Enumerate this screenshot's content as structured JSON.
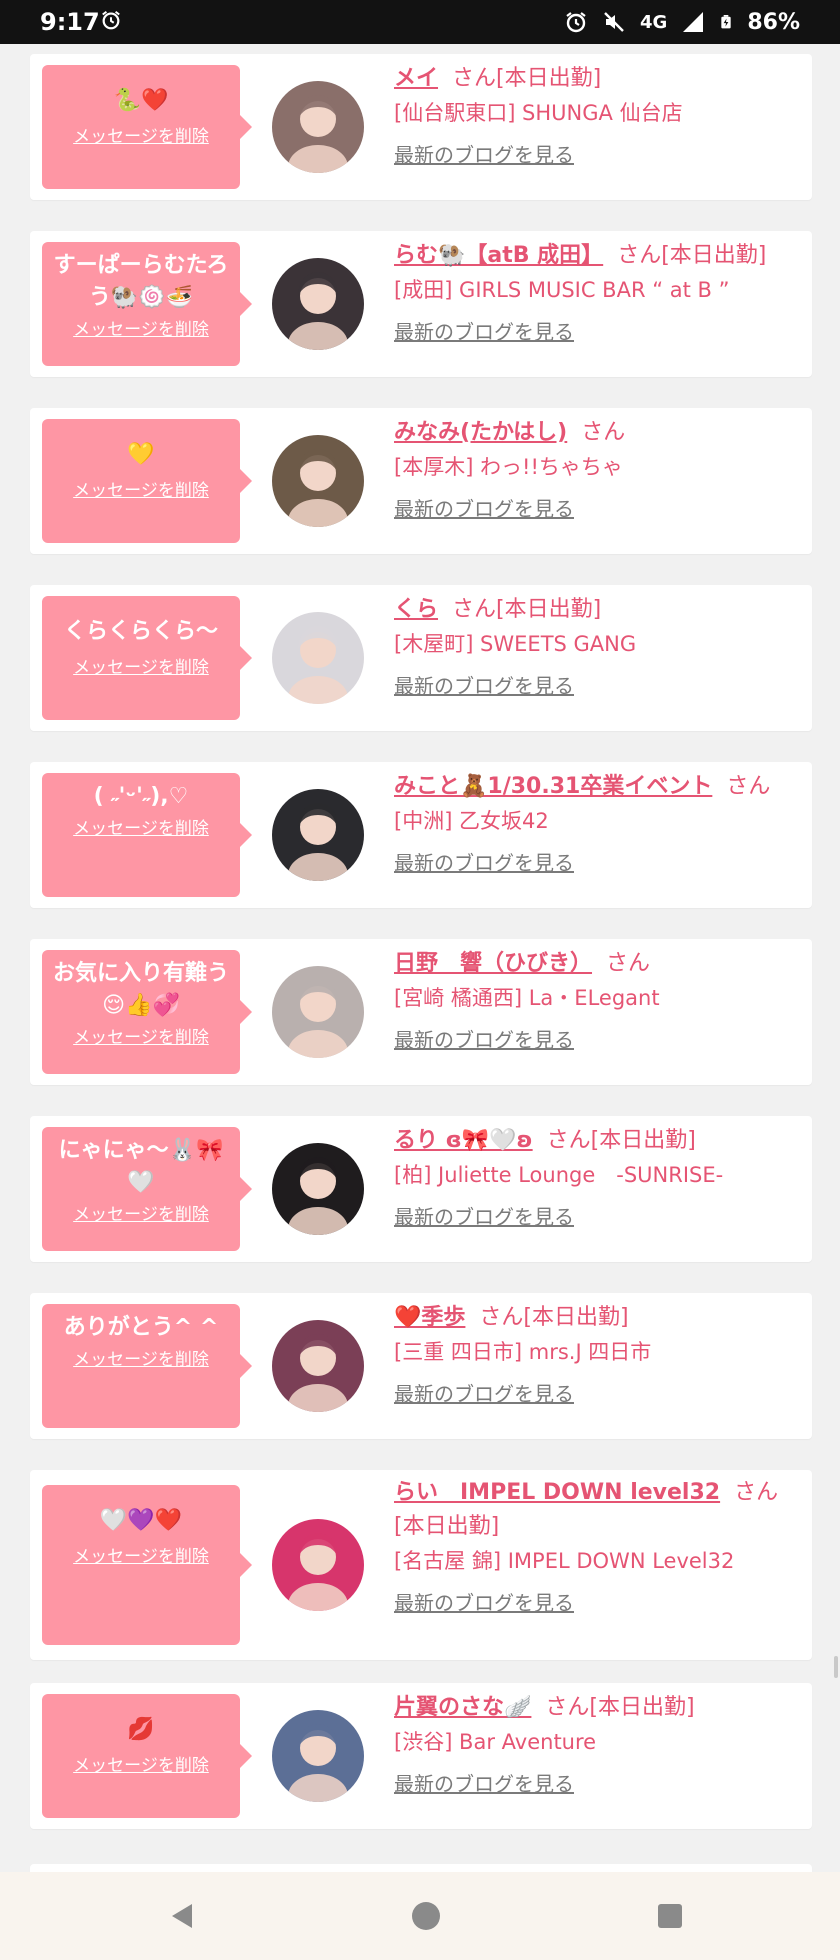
{
  "status": {
    "time": "9:17",
    "network": "4G",
    "battery": "86%"
  },
  "list": {
    "delete_label": "メッセージを削除",
    "blog_label": "最新のブログを見る",
    "items": [
      {
        "message": "🐍❤️",
        "name": "メイ",
        "suffix": "さん[本日出勤]",
        "shop": "[仙台駅東口] SHUNGA 仙台店",
        "avatar_color": "#8a6f6a"
      },
      {
        "message": "すーぱーらむたろう🐏🍥🍜",
        "name": "らむ🐏【atB 成田】",
        "suffix": "さん[本日出勤]",
        "shop": "[成田] GIRLS MUSIC BAR “ at B ”",
        "avatar_color": "#3b3337"
      },
      {
        "message": "💛",
        "name": "みなみ(たかはし)",
        "suffix": "さん",
        "shop": "[本厚木] わっ!!ちゃちゃ",
        "avatar_color": "#6d5a48"
      },
      {
        "message": "くらくらくら〜",
        "name": "くら",
        "suffix": "さん[本日出勤]",
        "shop": "[木屋町] SWEETS GANG",
        "avatar_color": "#d9d7dc"
      },
      {
        "message": "( ˶'ᵕ'˶),♡",
        "name": "みこと🧸1/30.31卒業イベント",
        "suffix": "さん",
        "shop": "[中洲] 乙女坂42",
        "avatar_color": "#2a2a2e"
      },
      {
        "message": "お気に入り有難う😌👍💞",
        "name": "日野　響（ひびき）",
        "suffix": "さん",
        "shop": "[宮崎 橘通西] La・ELegant",
        "avatar_color": "#b9b0ae"
      },
      {
        "message": "にゃにゃ〜🐰🎀🤍",
        "name": "るり ɞ🎀🤍ʚ",
        "suffix": "さん[本日出勤]",
        "shop": "[柏] Juliette Lounge　-SUNRISE-",
        "avatar_color": "#1f1c1e"
      },
      {
        "message": "ありがとう^ ^",
        "name": "❤️季歩",
        "suffix": "さん[本日出勤]",
        "shop": "[三重 四日市] mrs.J 四日市",
        "avatar_color": "#7b3f56"
      },
      {
        "message": "🤍💜❤️",
        "name": "らい　IMPEL DOWN level32",
        "suffix": "さん[本日出勤]",
        "shop": "[名古屋 錦] IMPEL DOWN Level32",
        "avatar_color": "#d7356c"
      },
      {
        "message": "💋",
        "name": "片翼のさな🪽",
        "suffix": "さん[本日出勤]",
        "shop": "[渋谷] Bar Aventure",
        "avatar_color": "#5c6f96"
      }
    ]
  }
}
